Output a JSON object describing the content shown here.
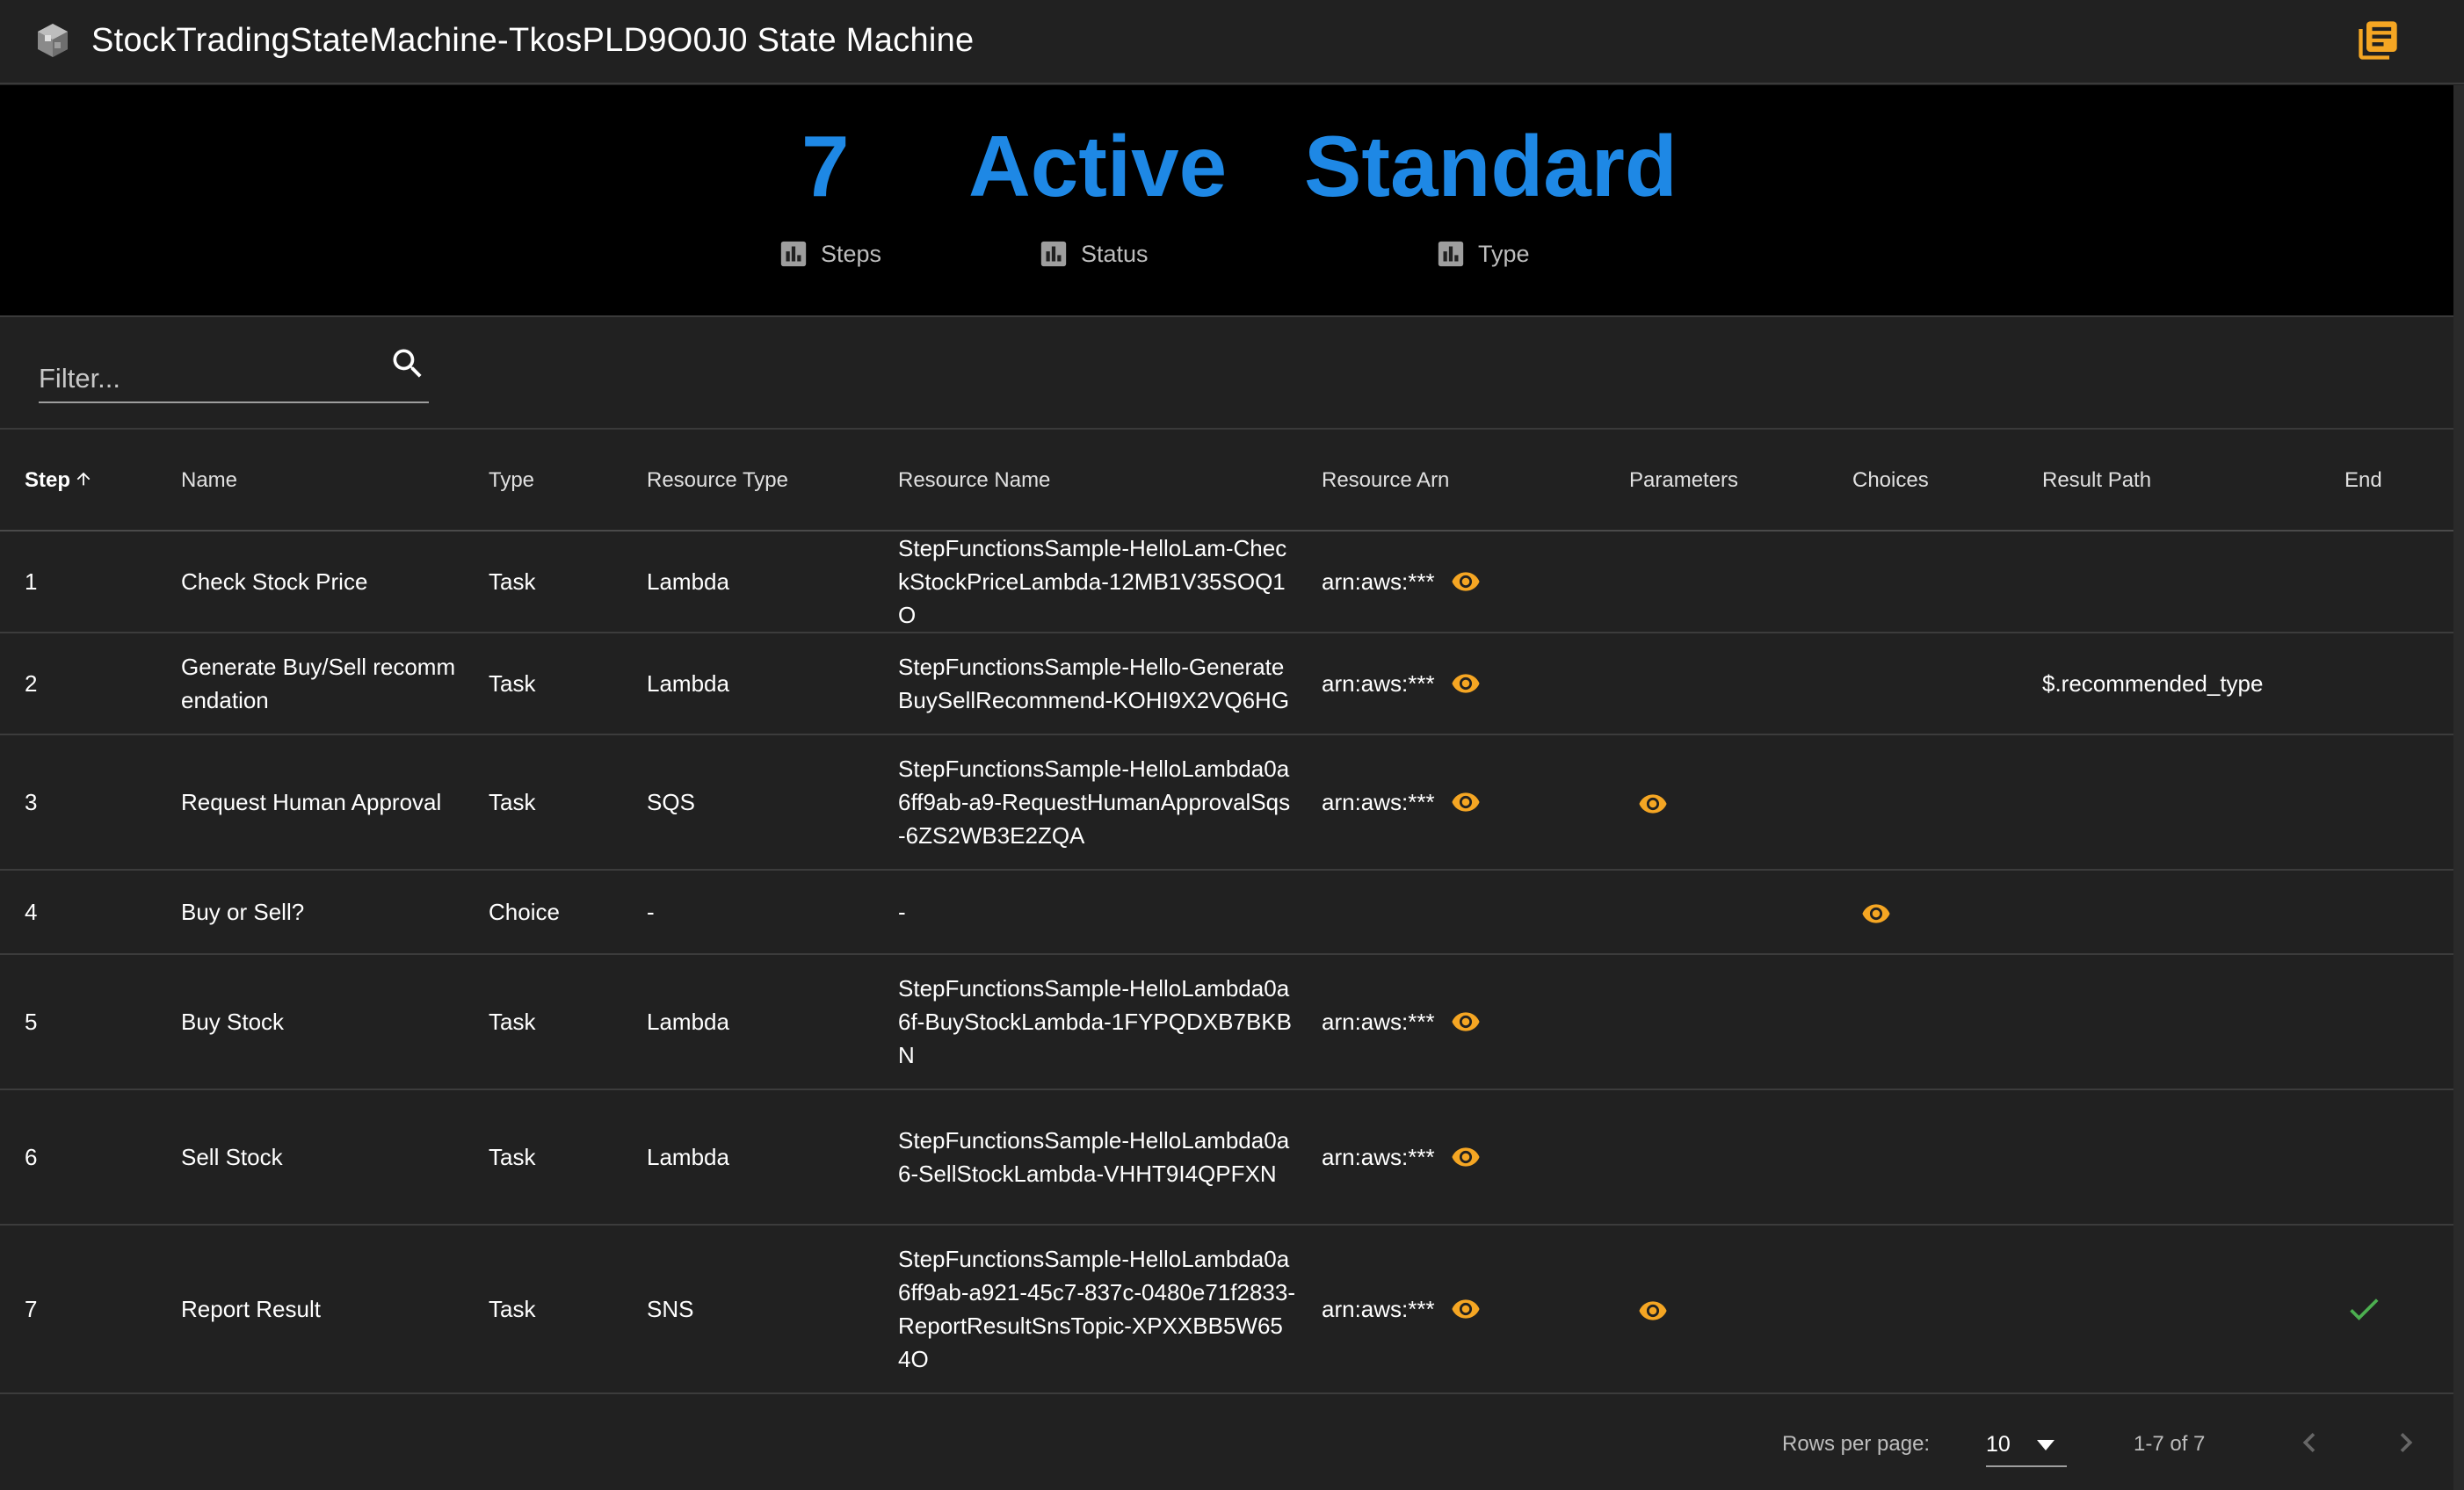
{
  "header": {
    "title": "StockTradingStateMachine-TkosPLD9O0J0 State Machine",
    "app_icon": "cube-icon",
    "docs_icon": "library-books-icon"
  },
  "stats": [
    {
      "value": "7",
      "label": "Steps",
      "icon": "bar-chart-icon"
    },
    {
      "value": "Active",
      "label": "Status",
      "icon": "bar-chart-icon"
    },
    {
      "value": "Standard",
      "label": "Type",
      "icon": "bar-chart-icon"
    }
  ],
  "filter": {
    "placeholder": "Filter...",
    "value": ""
  },
  "table": {
    "columns": [
      "Step",
      "Name",
      "Type",
      "Resource Type",
      "Resource Name",
      "Resource Arn",
      "Parameters",
      "Choices",
      "Result Path",
      "End"
    ],
    "sorted_column": "Step",
    "rows": [
      {
        "step": "1",
        "name": "Check Stock Price",
        "type": "Task",
        "resource_type": "Lambda",
        "resource_name": "StepFunctionsSample-HelloLam-CheckStockPriceLambda-12MB1V35SOQ1O",
        "resource_arn": "arn:aws:***",
        "parameters": false,
        "choices": false,
        "result_path": "",
        "end": false
      },
      {
        "step": "2",
        "name": "Generate Buy/Sell recommendation",
        "type": "Task",
        "resource_type": "Lambda",
        "resource_name": "StepFunctionsSample-Hello-GenerateBuySellRecommend-KOHI9X2VQ6HG",
        "resource_arn": "arn:aws:***",
        "parameters": false,
        "choices": false,
        "result_path": "$.recommended_type",
        "end": false
      },
      {
        "step": "3",
        "name": "Request Human Approval",
        "type": "Task",
        "resource_type": "SQS",
        "resource_name": "StepFunctionsSample-HelloLambda0a6ff9ab-a9-RequestHumanApprovalSqs-6ZS2WB3E2ZQA",
        "resource_arn": "arn:aws:***",
        "parameters": true,
        "choices": false,
        "result_path": "",
        "end": false
      },
      {
        "step": "4",
        "name": "Buy or Sell?",
        "type": "Choice",
        "resource_type": "-",
        "resource_name": "-",
        "resource_arn": "",
        "parameters": false,
        "choices": true,
        "result_path": "",
        "end": false
      },
      {
        "step": "5",
        "name": "Buy Stock",
        "type": "Task",
        "resource_type": "Lambda",
        "resource_name": "StepFunctionsSample-HelloLambda0a6f-BuyStockLambda-1FYPQDXB7BKBN",
        "resource_arn": "arn:aws:***",
        "parameters": false,
        "choices": false,
        "result_path": "",
        "end": false
      },
      {
        "step": "6",
        "name": "Sell Stock",
        "type": "Task",
        "resource_type": "Lambda",
        "resource_name": "StepFunctionsSample-HelloLambda0a6-SellStockLambda-VHHT9I4QPFXN",
        "resource_arn": "arn:aws:***",
        "parameters": false,
        "choices": false,
        "result_path": "",
        "end": false
      },
      {
        "step": "7",
        "name": "Report Result",
        "type": "Task",
        "resource_type": "SNS",
        "resource_name": "StepFunctionsSample-HelloLambda0a6ff9ab-a921-45c7-837c-0480e71f2833-ReportResultSnsTopic-XPXXBB5W654O",
        "resource_arn": "arn:aws:***",
        "parameters": true,
        "choices": false,
        "result_path": "",
        "end": true
      }
    ]
  },
  "pagination": {
    "rows_per_page_label": "Rows per page:",
    "rows_per_page": "10",
    "range": "1-7 of 7"
  },
  "colors": {
    "accent_blue": "#1e88e5",
    "icon_orange": "#f5a623",
    "check_green": "#4caf50"
  }
}
